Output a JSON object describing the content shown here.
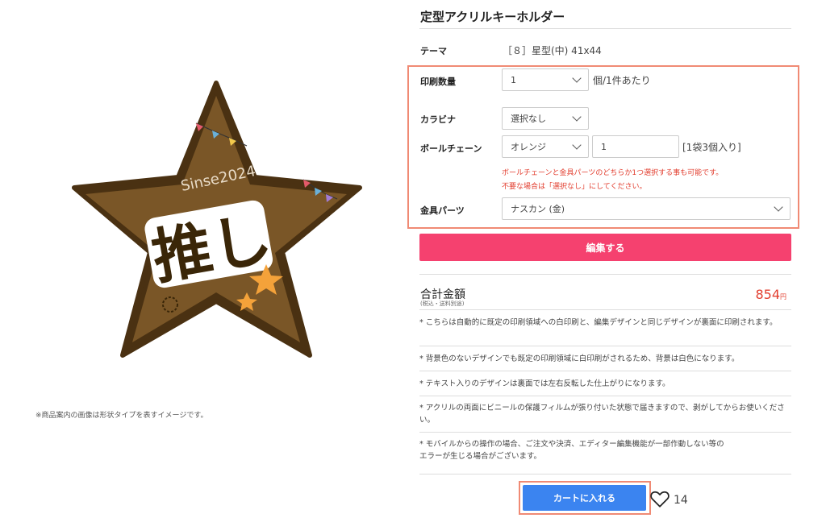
{
  "product": {
    "title": "定型アクリルキーホルダー",
    "image_note": "※商品案内の画像は形状タイプを表すイメージです。",
    "sample_image": {
      "caption_top": "Sinse2024",
      "main_text": "推し"
    }
  },
  "options": {
    "theme": {
      "label": "テーマ",
      "value": "［８］星型(中) 41x44"
    },
    "quantity": {
      "label": "印刷数量",
      "selected": "1",
      "suffix": "個/1件あたり"
    },
    "carabiner": {
      "label": "カラビナ",
      "selected": "選択なし"
    },
    "ball_chain": {
      "label": "ボールチェーン",
      "selected": "オレンジ",
      "quantity_value": "1",
      "suffix": "[1袋3個入り]",
      "warning_line1": "ボールチェーンと金具パーツのどちらか1つ選択する事も可能です。",
      "warning_line2": "不要な場合は「選択なし」にしてください。"
    },
    "metal_parts": {
      "label": "金具パーツ",
      "selected": "ナスカン (金)"
    }
  },
  "actions": {
    "edit_label": "編集する",
    "cart_label": "カートに入れる",
    "like_count": "14"
  },
  "total": {
    "label": "合計金額",
    "sublabel": "(税込・送料別途)",
    "price": "854",
    "currency": "円"
  },
  "notes": [
    "* こちらは自動的に既定の印刷領域への白印刷と、編集デザインと同じデザインが裏面に印刷されます。",
    "* 背景色のないデザインでも既定の印刷領域に白印刷がされるため、背景は白色になります。",
    "* テキスト入りのデザインは裏面では左右反転した仕上がりになります。",
    "* アクリルの両面にビニールの保護フィルムが張り付いた状態で届きますので、剥がしてからお使いください。",
    "* モバイルからの操作の場合、ご注文や決済、エディター編集機能が一部作動しない等の\nエラーが生じる場合がございます。"
  ],
  "colors": {
    "edit_button": "#f5416f",
    "cart_button": "#3b84f0",
    "price": "#e23d2e",
    "highlight_border": "#f08a74",
    "star_brown": "#6b4a1e"
  }
}
